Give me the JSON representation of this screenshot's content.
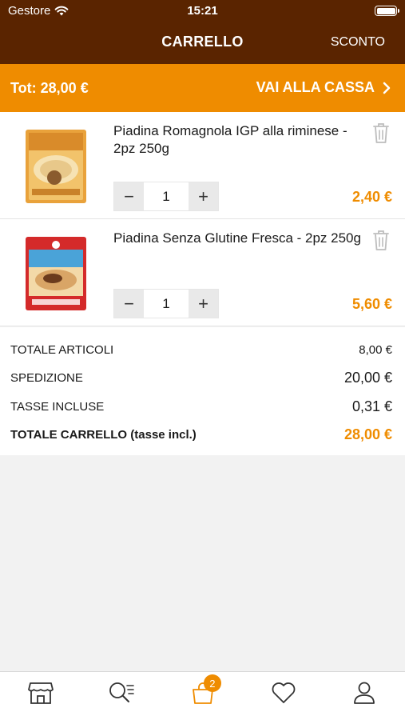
{
  "status": {
    "carrier": "Gestore",
    "time": "15:21"
  },
  "nav": {
    "title": "CARRELLO",
    "action": "SCONTO"
  },
  "checkout": {
    "total": "Tot: 28,00 €",
    "button": "VAI ALLA CASSA"
  },
  "items": [
    {
      "name": "Piadina Romagnola IGP alla riminese - 2pz 250g",
      "quantity": "1",
      "price": "2,40 €"
    },
    {
      "name": "Piadina Senza Glutine Fresca - 2pz 250g",
      "quantity": "1",
      "price": "5,60 €"
    }
  ],
  "totals": [
    {
      "label": "TOTALE ARTICOLI",
      "value": "8,00 €"
    },
    {
      "label": "SPEDIZIONE",
      "value": "20,00 €"
    },
    {
      "label": "TASSE INCLUSE",
      "value": "0,31 €"
    },
    {
      "label": "TOTALE CARRELLO (tasse incl.)",
      "value": "28,00 €"
    }
  ],
  "tabbar": {
    "tabs": [
      "shop-icon",
      "search-list-icon",
      "cart-icon",
      "heart-icon",
      "user-icon"
    ],
    "cart_badge": "2"
  },
  "colors": {
    "brand_brown": "#5a2400",
    "accent_orange": "#ef8c00"
  }
}
